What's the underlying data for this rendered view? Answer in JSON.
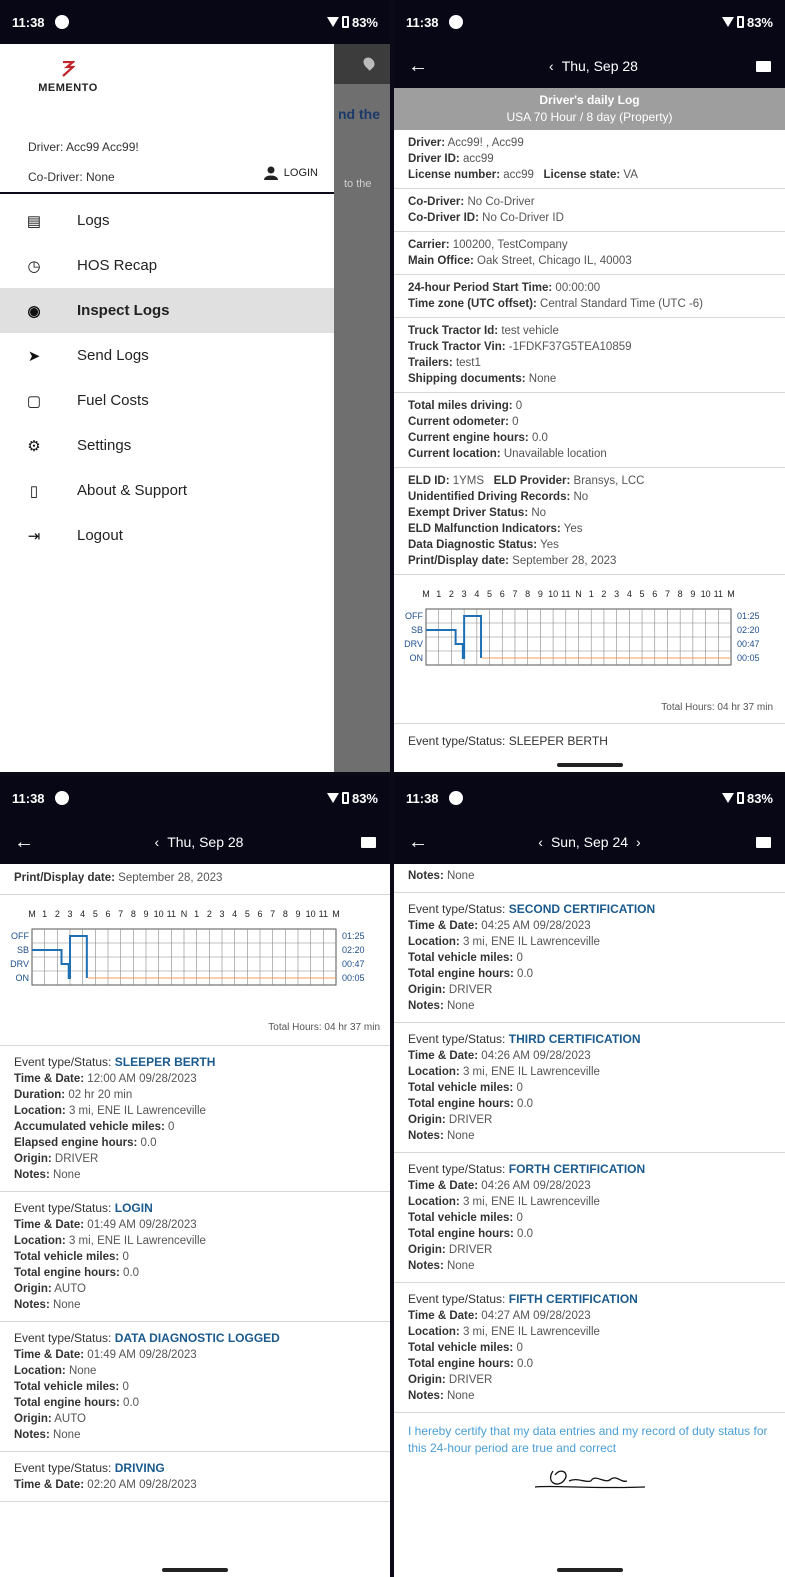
{
  "status": {
    "time": "11:38",
    "battery": "83%"
  },
  "drawer": {
    "logo_text": "MEMENTO",
    "driver": "Driver: Acc99 Acc99!",
    "codriver": "Co-Driver: None",
    "login_label": "LOGIN",
    "bg_text": "nd the",
    "bg_sub": "to the",
    "items": [
      {
        "label": "Logs",
        "icon": "list-icon"
      },
      {
        "label": "HOS Recap",
        "icon": "alarm-icon"
      },
      {
        "label": "Inspect Logs",
        "icon": "inspect-icon"
      },
      {
        "label": "Send Logs",
        "icon": "send-icon"
      },
      {
        "label": "Fuel Costs",
        "icon": "fuel-icon"
      },
      {
        "label": "Settings",
        "icon": "gear-icon"
      },
      {
        "label": "About & Support",
        "icon": "phone-icon"
      },
      {
        "label": "Logout",
        "icon": "logout-icon"
      }
    ]
  },
  "log": {
    "date": "Thu, Sep 28",
    "date2": "Sun, Sep 24",
    "header_title": "Driver's daily Log",
    "header_sub": "USA 70 Hour / 8 day (Property)",
    "driver": "Acc99! , Acc99",
    "driver_id": "acc99",
    "license_number": "acc99",
    "license_state": "VA",
    "codriver": "No Co-Driver",
    "codriver_id": "No Co-Driver ID",
    "carrier": "100200, TestCompany",
    "main_office": "Oak Street, Chicago IL, 40003",
    "period_start": "00:00:00",
    "timezone": "Central Standard Time (UTC -6)",
    "truck_id": "test vehicle",
    "truck_vin": "-1FDKF37G5TEA10859",
    "trailers": "test1",
    "shipping": "None",
    "total_miles": "0",
    "odometer": "0",
    "engine_hours": "0.0",
    "location": "Unavailable location",
    "eld_id": "1YMS",
    "eld_provider": "Bransys, LCC",
    "unidentified": "No",
    "exempt": "No",
    "malfunction": "Yes",
    "diagnostic": "Yes",
    "print_date": "September 28, 2023",
    "total_hours": "Total Hours: 04 hr  37 min",
    "cut_event": "Event type/Status: SLEEPER BERTH"
  },
  "grid": {
    "hours": [
      "M",
      "1",
      "2",
      "3",
      "4",
      "5",
      "6",
      "7",
      "8",
      "9",
      "10",
      "11",
      "N",
      "1",
      "2",
      "3",
      "4",
      "5",
      "6",
      "7",
      "8",
      "9",
      "10",
      "11",
      "M"
    ],
    "rows": [
      "OFF",
      "SB",
      "DRV",
      "ON"
    ],
    "totals": [
      "01:25",
      "02:20",
      "00:47",
      "00:05"
    ]
  },
  "events_left": [
    {
      "type": "SLEEPER BERTH",
      "fields": [
        [
          "Time & Date:",
          "12:00 AM 09/28/2023"
        ],
        [
          "Duration:",
          "02 hr  20 min"
        ],
        [
          "Location:",
          "3 mi, ENE IL Lawrenceville"
        ],
        [
          "Accumulated vehicle miles:",
          "0"
        ],
        [
          "Elapsed engine hours:",
          "0.0"
        ],
        [
          "Origin:",
          "DRIVER"
        ],
        [
          "Notes:",
          "None"
        ]
      ]
    },
    {
      "type": "LOGIN",
      "fields": [
        [
          "Time & Date:",
          "01:49 AM 09/28/2023"
        ],
        [
          "Location:",
          "3 mi, ENE IL Lawrenceville"
        ],
        [
          "Total vehicle miles:",
          "0"
        ],
        [
          "Total engine hours:",
          "0.0"
        ],
        [
          "Origin:",
          "AUTO"
        ],
        [
          "Notes:",
          "None"
        ]
      ]
    },
    {
      "type": "DATA DIAGNOSTIC LOGGED",
      "fields": [
        [
          "Time & Date:",
          "01:49 AM 09/28/2023"
        ],
        [
          "Location:",
          "None"
        ],
        [
          "Total vehicle miles:",
          "0"
        ],
        [
          "Total engine hours:",
          "0.0"
        ],
        [
          "Origin:",
          "AUTO"
        ],
        [
          "Notes:",
          "None"
        ]
      ]
    },
    {
      "type": "DRIVING",
      "fields": [
        [
          "Time & Date:",
          "02:20 AM 09/28/2023"
        ]
      ]
    }
  ],
  "events_right": [
    {
      "type": "SECOND CERTIFICATION",
      "fields": [
        [
          "Time & Date:",
          "04:25 AM 09/28/2023"
        ],
        [
          "Location:",
          "3 mi, ENE IL Lawrenceville"
        ],
        [
          "Total vehicle miles:",
          "0"
        ],
        [
          "Total engine hours:",
          "0.0"
        ],
        [
          "Origin:",
          "DRIVER"
        ],
        [
          "Notes:",
          "None"
        ]
      ]
    },
    {
      "type": "THIRD CERTIFICATION",
      "fields": [
        [
          "Time & Date:",
          "04:26 AM 09/28/2023"
        ],
        [
          "Location:",
          "3 mi, ENE IL Lawrenceville"
        ],
        [
          "Total vehicle miles:",
          "0"
        ],
        [
          "Total engine hours:",
          "0.0"
        ],
        [
          "Origin:",
          "DRIVER"
        ],
        [
          "Notes:",
          "None"
        ]
      ]
    },
    {
      "type": "FORTH CERTIFICATION",
      "fields": [
        [
          "Time & Date:",
          "04:26 AM 09/28/2023"
        ],
        [
          "Location:",
          "3 mi, ENE IL Lawrenceville"
        ],
        [
          "Total vehicle miles:",
          "0"
        ],
        [
          "Total engine hours:",
          "0.0"
        ],
        [
          "Origin:",
          "DRIVER"
        ],
        [
          "Notes:",
          "None"
        ]
      ]
    },
    {
      "type": "FIFTH CERTIFICATION",
      "fields": [
        [
          "Time & Date:",
          "04:27 AM 09/28/2023"
        ],
        [
          "Location:",
          "3 mi, ENE IL Lawrenceville"
        ],
        [
          "Total vehicle miles:",
          "0"
        ],
        [
          "Total engine hours:",
          "0.0"
        ],
        [
          "Origin:",
          "DRIVER"
        ],
        [
          "Notes:",
          "None"
        ]
      ]
    }
  ],
  "prev_notes": "None",
  "certify_text": "I hereby certify that my data entries and my record of duty status for this 24-hour period are true and correct",
  "colors": {
    "bar": "#070716",
    "accent": "#1a5a8e",
    "grid_line": "#1f6fb3",
    "on_line": "#f0a060"
  }
}
